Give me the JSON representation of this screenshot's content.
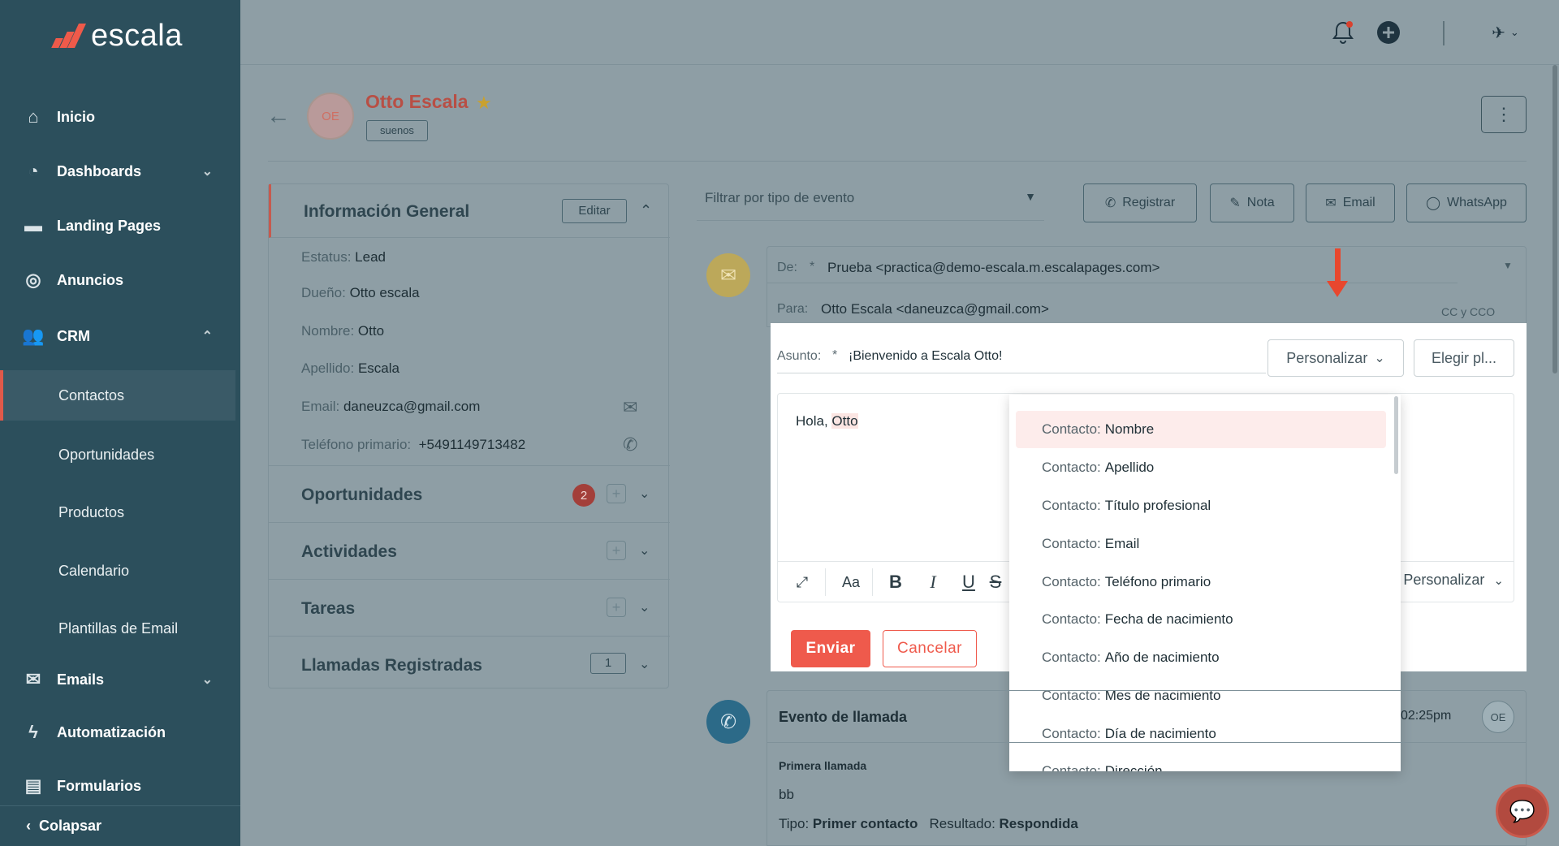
{
  "brand": {
    "name": "escala",
    "accent": "#ee5a4a"
  },
  "sidebar": {
    "items": [
      {
        "label": "Inicio",
        "icon": "home-icon"
      },
      {
        "label": "Dashboards",
        "icon": "pie-chart-icon"
      },
      {
        "label": "Landing Pages",
        "icon": "browser-icon"
      },
      {
        "label": "Anuncios",
        "icon": "target-icon"
      },
      {
        "label": "CRM",
        "icon": "users-icon"
      },
      {
        "label": "Emails",
        "icon": "mail-icon"
      },
      {
        "label": "Automatización",
        "icon": "bolt-icon"
      },
      {
        "label": "Formularios",
        "icon": "form-icon"
      }
    ],
    "crm_sub": [
      "Contactos",
      "Oportunidades",
      "Productos",
      "Calendario",
      "Plantillas de Email"
    ],
    "collapse": "Colapsar"
  },
  "contact": {
    "initials": "OE",
    "name": "Otto Escala",
    "tag": "suenos"
  },
  "general": {
    "title": "Información General",
    "edit": "Editar",
    "rows": [
      {
        "label": "Estatus:",
        "value": "Lead"
      },
      {
        "label": "Dueño:",
        "value": "Otto escala"
      },
      {
        "label": "Nombre:",
        "value": "Otto"
      },
      {
        "label": "Apellido:",
        "value": "Escala"
      },
      {
        "label": "Email:",
        "value": "daneuzca@gmail.com"
      },
      {
        "label": "Teléfono primario:",
        "value": "+5491149713482"
      }
    ]
  },
  "sections": {
    "oportunidades": {
      "title": "Oportunidades",
      "badge": "2"
    },
    "actividades": {
      "title": "Actividades"
    },
    "tareas": {
      "title": "Tareas"
    },
    "llamadas": {
      "title": "Llamadas Registradas",
      "count": "1"
    }
  },
  "timeline": {
    "filter_placeholder": "Filtrar por tipo de evento",
    "actions": [
      "Registrar",
      "Nota",
      "Email",
      "WhatsApp"
    ]
  },
  "email_form": {
    "from_label": "De:",
    "from_value": "Prueba <practica@demo-escala.m.escalapages.com>",
    "to_label": "Para:",
    "to_value": "Otto Escala <daneuzca@gmail.com>",
    "cc": "CC y CCO",
    "subject_label": "Asunto:",
    "subject_value": "¡Bienvenido a Escala Otto!",
    "personalize": "Personalizar",
    "choose_template": "Elegir pl...",
    "body_greeting": "Hola, ",
    "body_name": "Otto",
    "toolbar_personalize": "Personalizar",
    "send": "Enviar",
    "cancel": "Cancelar"
  },
  "dropdown": {
    "prefix": "Contacto:",
    "options": [
      "Nombre",
      "Apellido",
      "Título profesional",
      "Email",
      "Teléfono primario",
      "Fecha de nacimiento",
      "Año de nacimiento",
      "Mes de nacimiento",
      "Día de nacimiento",
      "Dirección"
    ],
    "selected_index": 0
  },
  "call_event": {
    "title": "Evento de llamada",
    "time": "02:25pm",
    "initials": "OE",
    "subtitle": "Primera llamada",
    "note": "bb",
    "type_label": "Tipo:",
    "type_value": "Primer contacto",
    "result_label": "Resultado:",
    "result_value": "Respondida"
  }
}
